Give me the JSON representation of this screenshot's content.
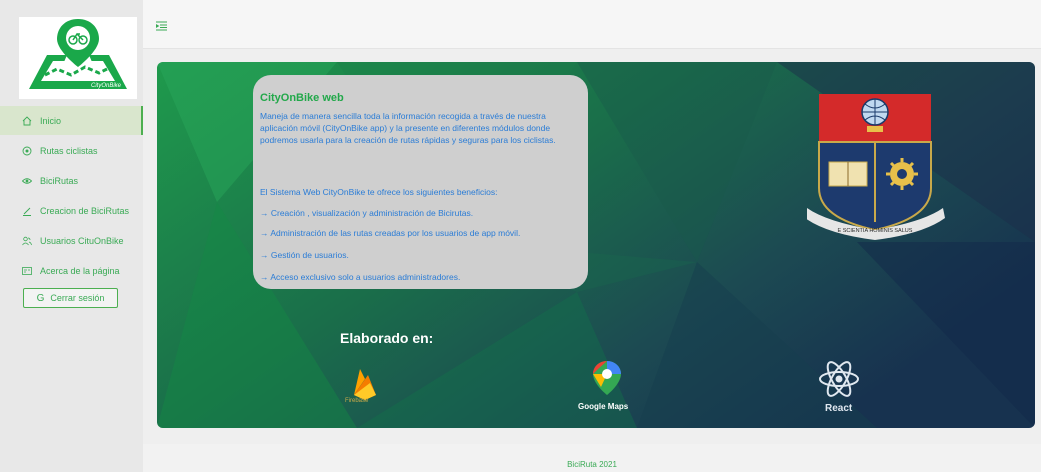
{
  "logo": {
    "text": "CityOnBike"
  },
  "sidebar": {
    "items": [
      {
        "label": "Inicio",
        "icon": "home-icon",
        "active": true
      },
      {
        "label": "Rutas ciclistas",
        "icon": "location-icon",
        "active": false
      },
      {
        "label": "BiciRutas",
        "icon": "eye-icon",
        "active": false
      },
      {
        "label": "Creacion de BiciRutas",
        "icon": "edit-icon",
        "active": false
      },
      {
        "label": "Usuarios CituOnBike",
        "icon": "users-icon",
        "active": false
      },
      {
        "label": "Acerca de la página",
        "icon": "info-card-icon",
        "active": false
      }
    ],
    "logout_label": "Cerrar sesión"
  },
  "topbar": {
    "menu_icon": "menu-fold-icon"
  },
  "card": {
    "title": "CityOnBike web",
    "description": "Maneja de manera sencilla toda la información recogida a través de nuestra aplicación móvil (CityOnBike app) y la presente en diferentes módulos donde podremos usarla para la creación de rutas rápidas y seguras para los ciclistas.",
    "benefits_intro": "El Sistema Web CityOnBike te ofrece los siguientes beneficios:",
    "benefits": [
      "→ Creación , visualización y administración de Bicirutas.",
      "→ Administración de las rutas creadas por los usuarios de app móvil.",
      "→ Gestión de usuarios.",
      "→ Acceso exclusivo solo a usuarios administradores."
    ]
  },
  "crest": {
    "motto": "E SCIENTIA HOMINIS SALUS"
  },
  "tech": {
    "title": "Elaborado en:",
    "items": [
      {
        "name": "Firebase",
        "icon": "firebase-icon"
      },
      {
        "name": "Google Maps",
        "icon": "google-maps-icon"
      },
      {
        "name": "React",
        "icon": "react-icon"
      }
    ]
  },
  "colors": {
    "accent": "#3aaa55",
    "link": "#2a7cd6",
    "hero_dark": "#1b3a4a",
    "hero_green": "#1f8a4a"
  },
  "footer": {
    "text": "BiciRuta 2021"
  }
}
